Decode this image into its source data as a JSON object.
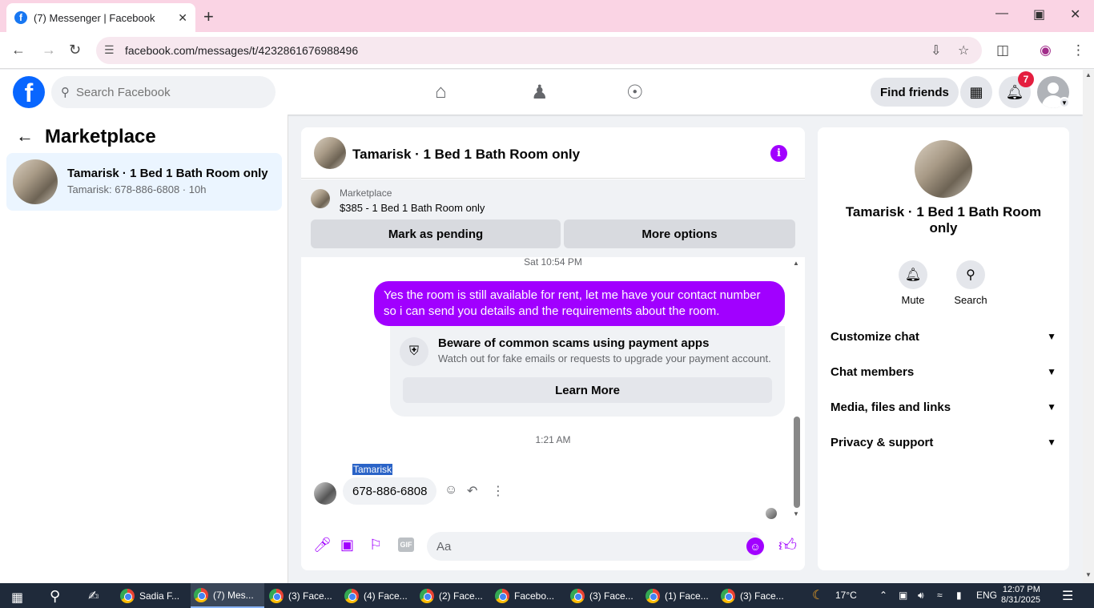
{
  "browser": {
    "tab_title": "(7) Messenger | Facebook",
    "tab_favicon": "f",
    "close_tab": "✕",
    "new_tab": "+",
    "url": "facebook.com/messages/t/4232861676988496"
  },
  "fb": {
    "logo": "f",
    "search_placeholder": "Search Facebook",
    "find_friends": "Find friends",
    "notifications_count": "7"
  },
  "left": {
    "title": "Marketplace",
    "conversation": {
      "name": "Tamarisk · 1 Bed 1 Bath Room only",
      "preview": "Tamarisk: 678-886-6808 · 10h"
    }
  },
  "chat": {
    "title": "Tamarisk · 1 Bed 1 Bath Room only",
    "info": "i",
    "marketplace_label": "Marketplace",
    "listing": "$385 - 1 Bed 1 Bath Room only",
    "mark_pending": "Mark as pending",
    "more_options": "More options",
    "time1": "Sat 10:54 PM",
    "outgoing": "Yes the room is still available for rent, let me have your contact number so i can send you details and the requirements about the room.",
    "warning_title": "Beware of common scams using payment apps",
    "warning_sub": "Watch out for fake emails or requests to upgrade your payment account.",
    "learn_more": "Learn More",
    "time2": "1:21 AM",
    "sender": "Tamarisk",
    "incoming": "678-886-6808",
    "composer_placeholder": "Aa",
    "gif": "GIF"
  },
  "right": {
    "name": "Tamarisk · 1 Bed 1 Bath Room only",
    "mute": "Mute",
    "search": "Search",
    "sections": [
      "Customize chat",
      "Chat members",
      "Media, files and links",
      "Privacy & support"
    ]
  },
  "taskbar": {
    "apps": [
      "Sadia F...",
      "(7) Mes...",
      "(3) Face...",
      "(4) Face...",
      "(2) Face...",
      "Facebo...",
      "(3) Face...",
      "(1) Face...",
      "(3) Face..."
    ],
    "weather": "17°C",
    "lang": "ENG",
    "time": "12:07 PM",
    "date": "8/31/2025"
  }
}
